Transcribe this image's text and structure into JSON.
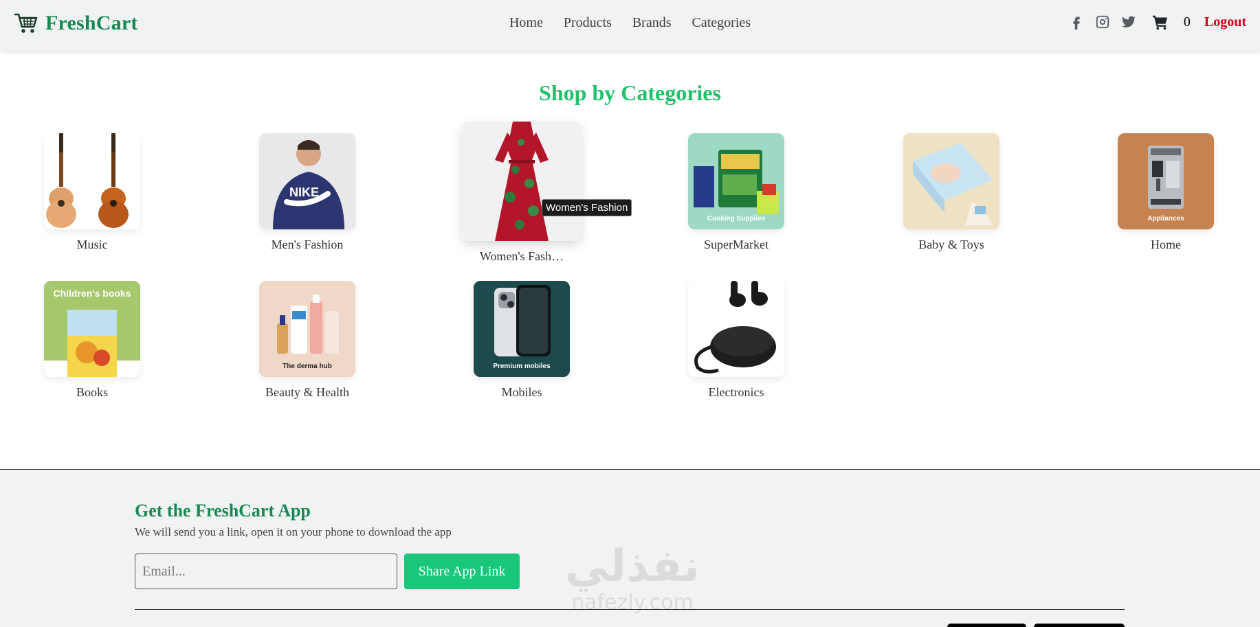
{
  "brand": {
    "name": "FreshCart",
    "icon": "shopping-cart-icon",
    "color": "#198754"
  },
  "nav": {
    "links": [
      "Home",
      "Products",
      "Brands",
      "Categories"
    ],
    "social_icons": [
      "facebook-icon",
      "instagram-icon",
      "twitter-icon"
    ],
    "cart_count": "0",
    "logout_label": "Logout"
  },
  "main": {
    "title": "Shop by Categories",
    "title_color": "#1ec26a",
    "categories": [
      {
        "name": "Music",
        "image_caption": ""
      },
      {
        "name": "Men's Fashion",
        "image_caption": ""
      },
      {
        "name": "Women's Fash…",
        "image_caption": ""
      },
      {
        "name": "SuperMarket",
        "image_caption": "Cooking Supplies"
      },
      {
        "name": "Baby & Toys",
        "image_caption": ""
      },
      {
        "name": "Home",
        "image_caption": "Appliances"
      },
      {
        "name": "Books",
        "image_caption": "Children's books"
      },
      {
        "name": "Beauty & Health",
        "image_caption": "The derma hub"
      },
      {
        "name": "Mobiles",
        "image_caption": "Premium mobiles"
      },
      {
        "name": "Electronics",
        "image_caption": ""
      }
    ],
    "tooltip": "Women's Fashion"
  },
  "footer": {
    "title": "Get the FreshCart App",
    "subtitle": "We will send you a link, open it on your phone to download the app",
    "email_placeholder": "Email...",
    "share_button": "Share App Link",
    "button_color": "#19c77b"
  },
  "watermark": {
    "arabic": "نفذلي",
    "latin": "nafezly.com"
  }
}
